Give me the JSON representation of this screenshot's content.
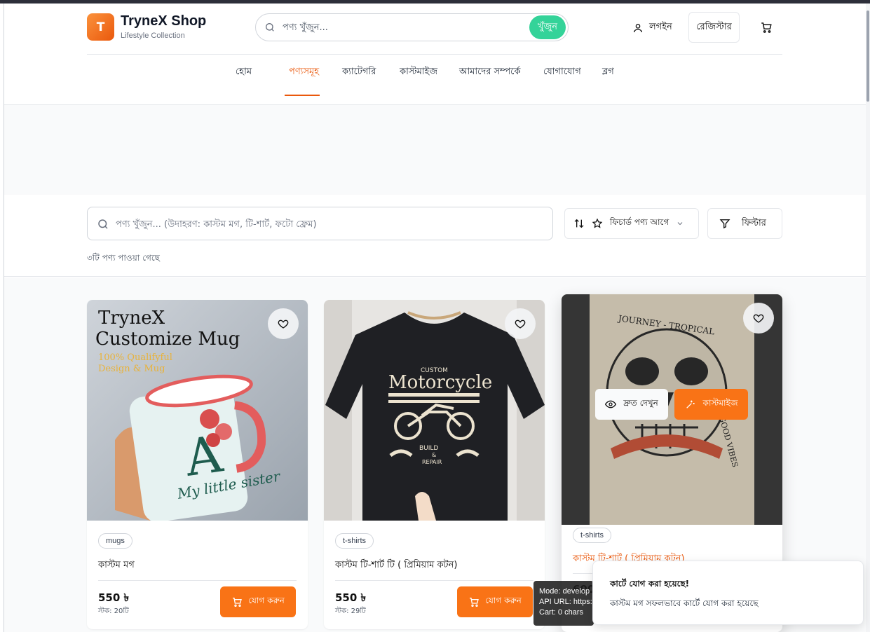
{
  "brand": {
    "logo_letter": "T",
    "name": "TryneX Shop",
    "tagline": "Lifestyle Collection"
  },
  "header": {
    "search_placeholder": "পণ্য খুঁজুন...",
    "search_button": "খুঁজুন",
    "login_label": "লগইন",
    "register_label": "রেজিস্টার"
  },
  "nav": {
    "items": [
      "হোম",
      "পণ্যসমূহ",
      "ক্যাটেগরি",
      "কাস্টমাইজ",
      "আমাদের সম্পর্কে",
      "যোগাযোগ",
      "ব্লগ"
    ],
    "active_index": 1
  },
  "filters": {
    "search_placeholder": "পণ্য খুঁজুন... (উদাহরণ: কাস্টম মগ, টি-শার্ট, ফটো ফ্রেম)",
    "sort_label": "ফিচার্ড পণ্য আগে",
    "filter_label": "ফিল্টার",
    "result_count": "৩টি পণ্য পাওয়া গেছে"
  },
  "products": [
    {
      "category": "mugs",
      "name": "কাস্টম মগ",
      "price": "550 ৳",
      "stock": "স্টক: 20টি",
      "add_label": "যোগ করুন",
      "image_text": {
        "title1": "TryneX",
        "title2": "Customize Mug",
        "sub1": "100% Qualifyful",
        "sub2": "Design & Mug",
        "mug_text": "My little sister"
      }
    },
    {
      "category": "t-shirts",
      "name": "কাস্টম টি-শার্ট টি ( প্রিমিয়াম কটন)",
      "price": "550 ৳",
      "stock": "স্টক: 29টি",
      "add_label": "যোগ করুন",
      "image_text": {
        "small": "CUSTOM",
        "big": "Motorcycle",
        "sub1": "BUILD",
        "sub2": "&",
        "sub3": "REPAIR"
      }
    },
    {
      "category": "t-shirts",
      "name": "কাস্টম টি-শার্ট ( প্রিমিয়াম কটন)",
      "price": "600",
      "quick_view": "দ্রুত দেখুন",
      "customize": "কাস্টমাইজ",
      "image_text": {
        "top": "JOURNEY - TROPICAL",
        "side": "GOOD VIBES"
      }
    }
  ],
  "dev_panel": {
    "line1": "Mode: develop",
    "line2": "API URL: https:",
    "line3": "Cart: 0 chars"
  },
  "toast": {
    "title": "কার্টে যোগ করা হয়েছে!",
    "message": "কাস্টম মগ সফলভাবে কার্টে যোগ করা হয়েছে"
  },
  "colors": {
    "accent": "#f97316",
    "search_button": "#34d399",
    "active_nav": "#ea580c"
  }
}
